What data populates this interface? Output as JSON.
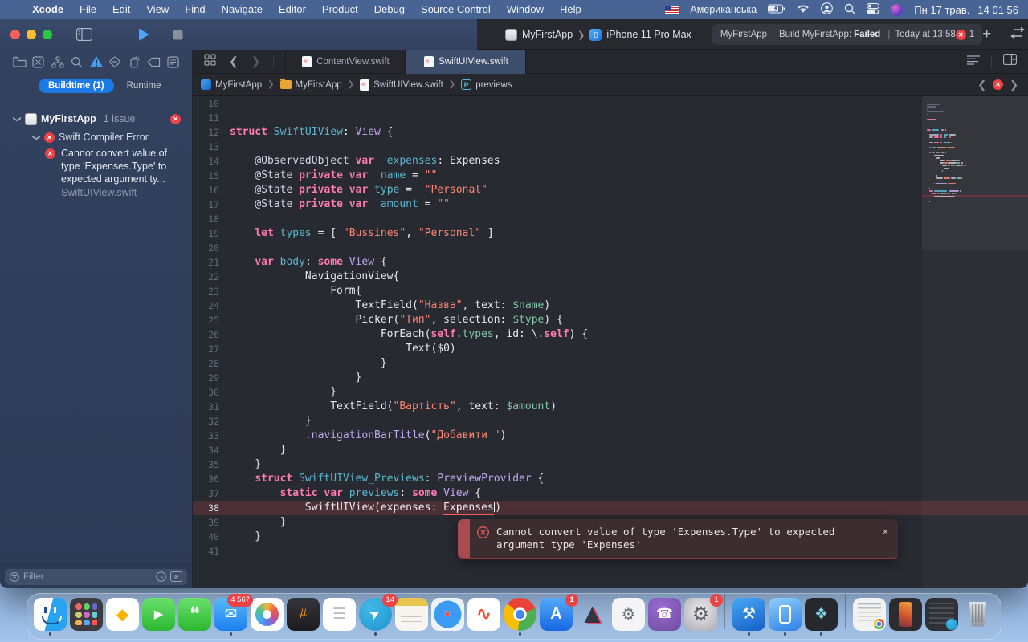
{
  "menu_bar": {
    "apple": "",
    "app_menu": "Xcode",
    "items": [
      "File",
      "Edit",
      "View",
      "Find",
      "Navigate",
      "Editor",
      "Product",
      "Debug",
      "Source Control",
      "Window",
      "Help"
    ],
    "input_source": "Американська",
    "status_icons": [
      "battery-icon",
      "wifi-icon",
      "user-icon",
      "search-icon",
      "control-center-icon",
      "assistant-icon"
    ],
    "clock_date": "Пн 17 трав.",
    "clock_time": "14 01 56"
  },
  "toolbar": {
    "scheme_target": "MyFirstApp",
    "scheme_device": "iPhone 11 Pro Max",
    "status_project": "MyFirstApp",
    "status_separator": "|",
    "status_action": "Build MyFirstApp:",
    "status_result": "Failed",
    "status_time": "Today at 13:58",
    "error_count": "1"
  },
  "navigator": {
    "icons": [
      "project-navigator",
      "source-control-navigator",
      "symbol-navigator",
      "find-navigator",
      "issue-navigator",
      "test-navigator",
      "debug-navigator",
      "breakpoint-navigator",
      "report-navigator"
    ],
    "selected_icon_index": 4,
    "buildtime_label": "Buildtime (1)",
    "runtime_label": "Runtime",
    "project_name": "MyFirstApp",
    "issue_count_label": "1 issue",
    "error_group": "Swift Compiler Error",
    "error_message": "Cannot convert value of type 'Expenses.Type' to expected argument ty...",
    "error_file": "SwiftUIView.swift",
    "filter_placeholder": "Filter"
  },
  "editor": {
    "tabs": [
      {
        "label": "ContentView.swift",
        "active": false
      },
      {
        "label": "SwiftUIView.swift",
        "active": true
      }
    ],
    "breadcrumb": [
      {
        "type": "app",
        "label": "MyFirstApp"
      },
      {
        "type": "folder",
        "label": "MyFirstApp"
      },
      {
        "type": "file",
        "label": "SwiftUIView.swift"
      },
      {
        "type": "previews",
        "label": "previews",
        "badge": "P"
      }
    ],
    "lines": [
      {
        "n": 10,
        "s": []
      },
      {
        "n": 11,
        "s": []
      },
      {
        "n": 12,
        "s": [
          [
            "k",
            "struct"
          ],
          [
            "p",
            " "
          ],
          [
            "t",
            "SwiftUIView"
          ],
          [
            "p",
            ": "
          ],
          [
            "u",
            "View"
          ],
          [
            "p",
            " {"
          ]
        ]
      },
      {
        "n": 13,
        "s": []
      },
      {
        "n": 14,
        "s": [
          [
            "p",
            "    "
          ],
          [
            "a",
            "@ObservedObject"
          ],
          [
            "p",
            " "
          ],
          [
            "k",
            "var"
          ],
          [
            "p",
            "  "
          ],
          [
            "t",
            "expenses"
          ],
          [
            "p",
            ": Expenses"
          ]
        ]
      },
      {
        "n": 15,
        "s": [
          [
            "p",
            "    "
          ],
          [
            "a",
            "@State"
          ],
          [
            "p",
            " "
          ],
          [
            "k",
            "private"
          ],
          [
            "p",
            " "
          ],
          [
            "k",
            "var"
          ],
          [
            "p",
            "  "
          ],
          [
            "t",
            "name"
          ],
          [
            "p",
            " = "
          ],
          [
            "s",
            "\"\""
          ]
        ]
      },
      {
        "n": 16,
        "s": [
          [
            "p",
            "    "
          ],
          [
            "a",
            "@State"
          ],
          [
            "p",
            " "
          ],
          [
            "k",
            "private"
          ],
          [
            "p",
            " "
          ],
          [
            "k",
            "var"
          ],
          [
            "p",
            " "
          ],
          [
            "t",
            "type"
          ],
          [
            "p",
            " =  "
          ],
          [
            "s",
            "\"Personal\""
          ]
        ]
      },
      {
        "n": 17,
        "s": [
          [
            "p",
            "    "
          ],
          [
            "a",
            "@State"
          ],
          [
            "p",
            " "
          ],
          [
            "k",
            "private"
          ],
          [
            "p",
            " "
          ],
          [
            "k",
            "var"
          ],
          [
            "p",
            "  "
          ],
          [
            "t",
            "amount"
          ],
          [
            "p",
            " = "
          ],
          [
            "s",
            "\"\""
          ]
        ]
      },
      {
        "n": 18,
        "s": []
      },
      {
        "n": 19,
        "s": [
          [
            "p",
            "    "
          ],
          [
            "k",
            "let"
          ],
          [
            "p",
            " "
          ],
          [
            "t",
            "types"
          ],
          [
            "p",
            " = [ "
          ],
          [
            "s",
            "\"Bussines\""
          ],
          [
            "p",
            ", "
          ],
          [
            "s",
            "\"Personal\""
          ],
          [
            "p",
            " ]"
          ]
        ]
      },
      {
        "n": 20,
        "s": []
      },
      {
        "n": 21,
        "s": [
          [
            "p",
            "    "
          ],
          [
            "k",
            "var"
          ],
          [
            "p",
            " "
          ],
          [
            "t",
            "body"
          ],
          [
            "p",
            ": "
          ],
          [
            "k",
            "some"
          ],
          [
            "p",
            " "
          ],
          [
            "u",
            "View"
          ],
          [
            "p",
            " {"
          ]
        ]
      },
      {
        "n": 22,
        "s": [
          [
            "p",
            "            NavigationView{"
          ]
        ]
      },
      {
        "n": 23,
        "s": [
          [
            "p",
            "                Form{"
          ]
        ]
      },
      {
        "n": 24,
        "s": [
          [
            "p",
            "                    TextField("
          ],
          [
            "s",
            "\"Назва\""
          ],
          [
            "p",
            ", text: "
          ],
          [
            "v",
            "$name"
          ],
          [
            "p",
            ")"
          ]
        ]
      },
      {
        "n": 25,
        "s": [
          [
            "p",
            "                    Picker("
          ],
          [
            "s",
            "\"Тип\""
          ],
          [
            "p",
            ", selection: "
          ],
          [
            "v",
            "$type"
          ],
          [
            "p",
            ") {"
          ]
        ]
      },
      {
        "n": 26,
        "s": [
          [
            "p",
            "                        ForEach("
          ],
          [
            "k",
            "self"
          ],
          [
            "p",
            "."
          ],
          [
            "v",
            "types"
          ],
          [
            "p",
            ", id: \\."
          ],
          [
            "k",
            "self"
          ],
          [
            "p",
            ") {"
          ]
        ]
      },
      {
        "n": 27,
        "s": [
          [
            "p",
            "                            Text($0)"
          ]
        ]
      },
      {
        "n": 28,
        "s": [
          [
            "p",
            "                        }"
          ]
        ]
      },
      {
        "n": 29,
        "s": [
          [
            "p",
            "                    }"
          ]
        ]
      },
      {
        "n": 30,
        "s": [
          [
            "p",
            "                }"
          ]
        ]
      },
      {
        "n": 31,
        "s": [
          [
            "p",
            "                TextField("
          ],
          [
            "s",
            "\"Вартість\""
          ],
          [
            "p",
            ", text: "
          ],
          [
            "v",
            "$amount"
          ],
          [
            "p",
            ")"
          ]
        ]
      },
      {
        "n": 32,
        "s": [
          [
            "p",
            "            }"
          ]
        ]
      },
      {
        "n": 33,
        "s": [
          [
            "p",
            "            ."
          ],
          [
            "u",
            "navigationBarTitle"
          ],
          [
            "p",
            "("
          ],
          [
            "s",
            "\"Добавити \""
          ],
          [
            "p",
            ")"
          ]
        ]
      },
      {
        "n": 34,
        "s": [
          [
            "p",
            "        }"
          ]
        ]
      },
      {
        "n": 35,
        "s": [
          [
            "p",
            "    }"
          ]
        ]
      },
      {
        "n": 36,
        "s": [
          [
            "p",
            "    "
          ],
          [
            "k",
            "struct"
          ],
          [
            "p",
            " "
          ],
          [
            "t",
            "SwiftUIView_Previews"
          ],
          [
            "p",
            ": "
          ],
          [
            "u",
            "PreviewProvider"
          ],
          [
            "p",
            " {"
          ]
        ]
      },
      {
        "n": 37,
        "s": [
          [
            "p",
            "        "
          ],
          [
            "k",
            "static"
          ],
          [
            "p",
            " "
          ],
          [
            "k",
            "var"
          ],
          [
            "p",
            " "
          ],
          [
            "t",
            "previews"
          ],
          [
            "p",
            ": "
          ],
          [
            "k",
            "some"
          ],
          [
            "p",
            " "
          ],
          [
            "u",
            "View"
          ],
          [
            "p",
            " {"
          ]
        ]
      },
      {
        "n": 38,
        "hl": true,
        "s": [
          [
            "p",
            "            SwiftUIView(expenses: "
          ],
          [
            "e",
            "Expenses"
          ],
          [
            "c",
            ""
          ],
          [
            "p",
            ")"
          ]
        ]
      },
      {
        "n": 39,
        "s": [
          [
            "p",
            "        }"
          ]
        ]
      },
      {
        "n": 40,
        "s": [
          [
            "p",
            "    }"
          ]
        ]
      },
      {
        "n": 41,
        "s": []
      }
    ],
    "minimap_top_rows": [
      [
        2,
        "cm"
      ],
      [
        20,
        "cm"
      ],
      [
        14,
        "cm"
      ],
      [
        2,
        "cm"
      ],
      [
        26,
        "cm"
      ],
      [
        2,
        "cm"
      ],
      [
        0,
        "cm"
      ],
      [
        15,
        "impk"
      ],
      [
        0,
        "cm"
      ]
    ],
    "error_popup": {
      "message": "Cannot convert value of type 'Expenses.Type' to expected argument type 'Expenses'",
      "close_label": "✕"
    }
  },
  "dock": {
    "items": [
      {
        "name": "finder",
        "cls": "finder",
        "dot": true
      },
      {
        "name": "launchpad",
        "cls": "launchpad"
      },
      {
        "name": "sketch",
        "cls": "sketch",
        "glyph": "◆"
      },
      {
        "name": "facetime",
        "cls": "facetime",
        "glyph": "▶"
      },
      {
        "name": "messages",
        "cls": "messages",
        "glyph": "❝"
      },
      {
        "name": "mail",
        "cls": "mail",
        "glyph": "✉",
        "badge": "4 567",
        "dot": true
      },
      {
        "name": "photos",
        "cls": "photos"
      },
      {
        "name": "calculator",
        "cls": "calculator",
        "glyph": "#"
      },
      {
        "name": "reminders",
        "cls": "reminders",
        "glyph": "☰"
      },
      {
        "name": "telegram",
        "cls": "telegram",
        "glyph": "➤",
        "badge": "14",
        "dot": true
      },
      {
        "name": "notes",
        "cls": "notes"
      },
      {
        "name": "safari",
        "cls": "safari",
        "glyph": "✦"
      },
      {
        "name": "swift-playgrounds",
        "cls": "swiftpg",
        "glyph": "∿"
      },
      {
        "name": "chrome",
        "cls": "chrome",
        "dot": true
      },
      {
        "name": "app-store",
        "cls": "appstore",
        "glyph": "A",
        "badge": "1"
      },
      {
        "name": "pyramid-app",
        "cls": "pyramid",
        "glyph": "▲"
      },
      {
        "name": "measure-app",
        "cls": "measure",
        "glyph": "⚙"
      },
      {
        "name": "viber",
        "cls": "viber",
        "glyph": "☎"
      },
      {
        "name": "system-preferences",
        "cls": "prefs",
        "glyph": "⚙",
        "badge": "1"
      },
      {
        "divider": true
      },
      {
        "name": "xcode",
        "cls": "xcode",
        "glyph": "⚒",
        "dot": true
      },
      {
        "name": "simulator",
        "cls": "simulator",
        "dot": true
      },
      {
        "name": "game-app",
        "cls": "game",
        "glyph": "❖",
        "dot": true
      },
      {
        "divider": true
      },
      {
        "name": "minimized-browser-window",
        "cls": "winbrowser"
      },
      {
        "name": "minimized-simulator-window",
        "cls": "winphone"
      },
      {
        "name": "minimized-chat-window",
        "cls": "winchat"
      },
      {
        "name": "trash",
        "cls": "trash"
      }
    ]
  }
}
